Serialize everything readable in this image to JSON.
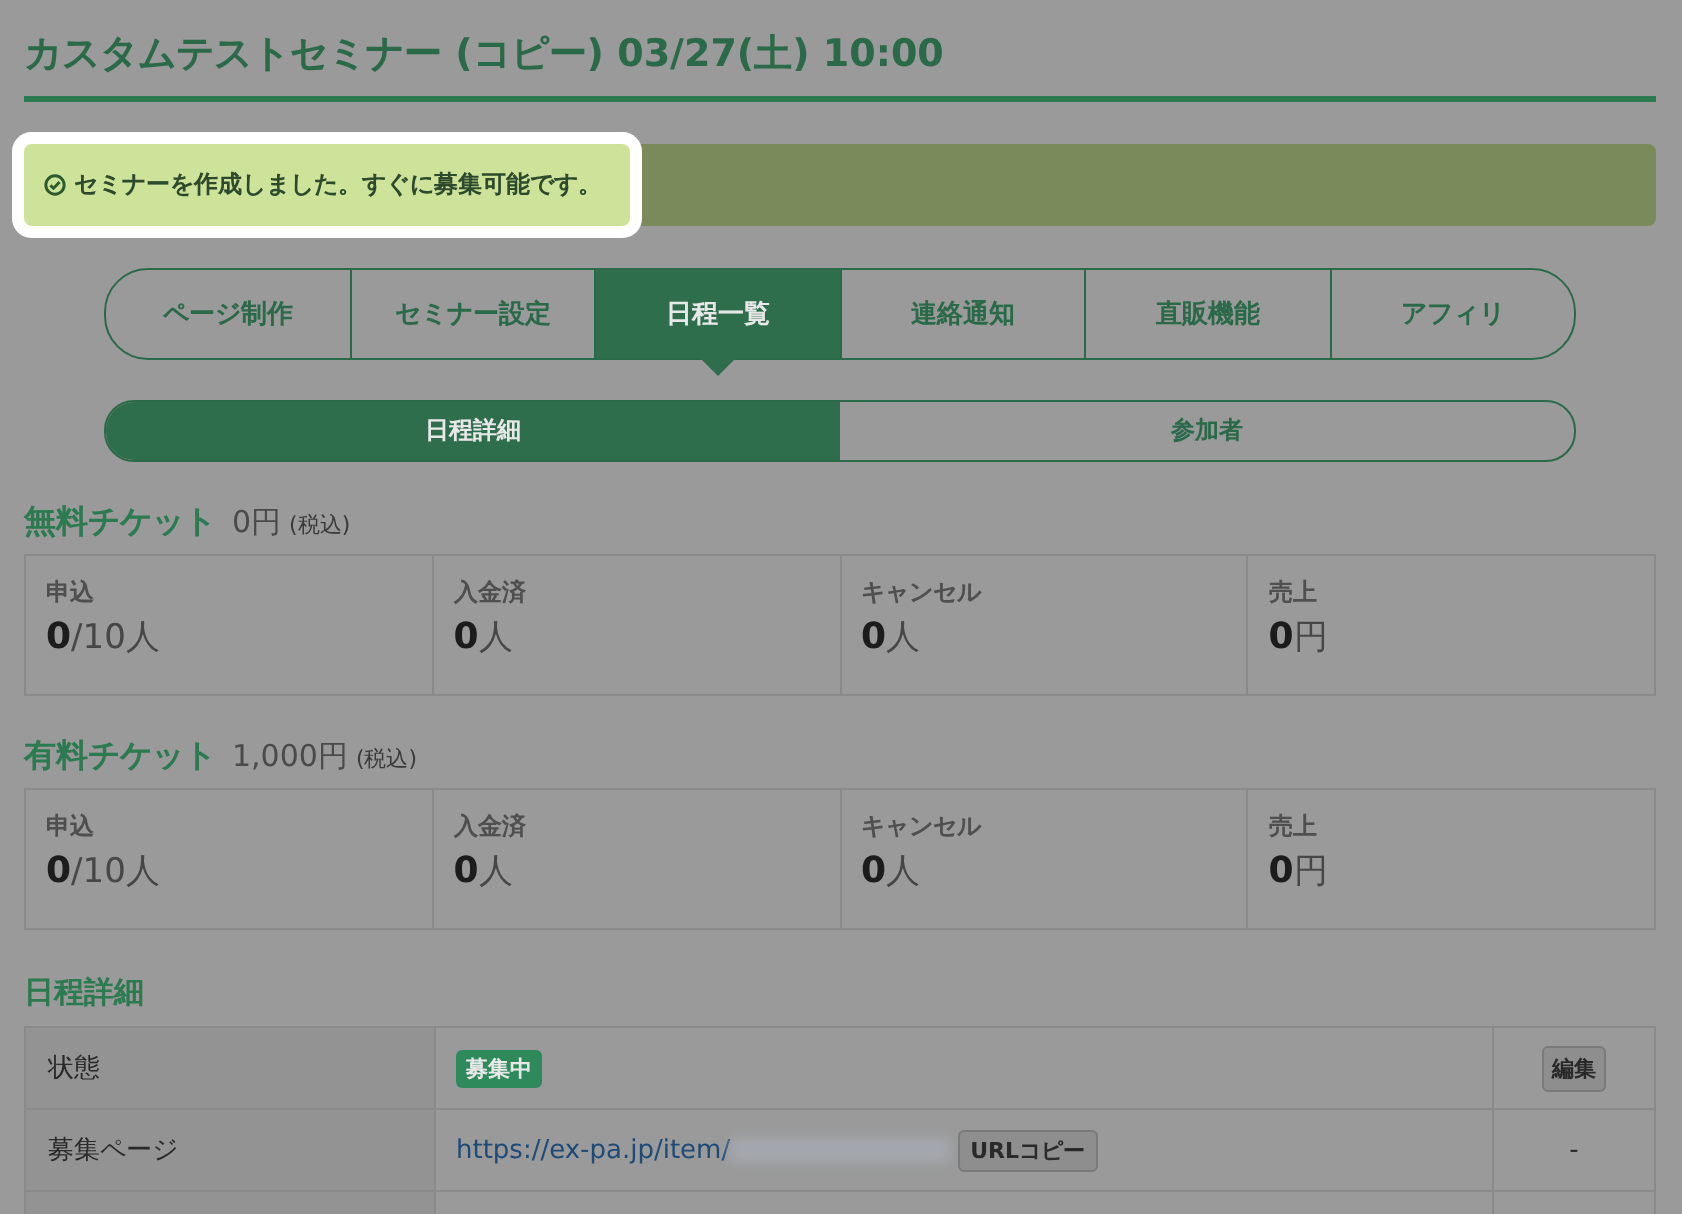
{
  "title": "カスタムテストセミナー (コピー) 03/27(土) 10:00",
  "notification": {
    "text": "セミナーを作成しました。すぐに募集可能です。",
    "highlighted": true
  },
  "tabs": [
    {
      "label": "ページ制作",
      "selected": false
    },
    {
      "label": "セミナー設定",
      "selected": false
    },
    {
      "label": "日程一覧",
      "selected": true
    },
    {
      "label": "連絡通知",
      "selected": false
    },
    {
      "label": "直販機能",
      "selected": false
    },
    {
      "label": "アフィリ",
      "selected": false
    }
  ],
  "subtabs": [
    {
      "label": "日程詳細",
      "selected": true
    },
    {
      "label": "参加者",
      "selected": false
    }
  ],
  "tickets": [
    {
      "name": "無料チケット",
      "price": "0円",
      "tax": "(税込)",
      "stats": [
        {
          "label": "申込",
          "value": "0",
          "suffix": "/10人"
        },
        {
          "label": "入金済",
          "value": "0",
          "suffix": "人"
        },
        {
          "label": "キャンセル",
          "value": "0",
          "suffix": "人"
        },
        {
          "label": "売上",
          "value": "0",
          "suffix": "円"
        }
      ]
    },
    {
      "name": "有料チケット",
      "price": "1,000円",
      "tax": "(税込)",
      "stats": [
        {
          "label": "申込",
          "value": "0",
          "suffix": "/10人"
        },
        {
          "label": "入金済",
          "value": "0",
          "suffix": "人"
        },
        {
          "label": "キャンセル",
          "value": "0",
          "suffix": "人"
        },
        {
          "label": "売上",
          "value": "0",
          "suffix": "円"
        }
      ]
    }
  ],
  "details": {
    "heading": "日程詳細",
    "rows": [
      {
        "label": "状態",
        "kind": "badge",
        "value": "募集中",
        "action": {
          "kind": "button",
          "label": "編集"
        }
      },
      {
        "label": "募集ページ",
        "kind": "link",
        "value": "https://ex-pa.jp/item/",
        "copy": "URLコピー",
        "action": {
          "kind": "text",
          "label": "-"
        }
      }
    ]
  }
}
